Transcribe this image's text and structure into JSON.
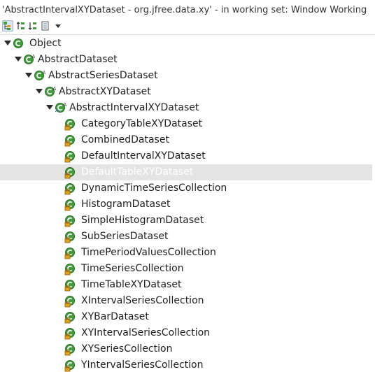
{
  "window": {
    "title": "'AbstractIntervalXYDataset - org.jfree.data.xy' - in working set: Window Working"
  },
  "toolbar": {
    "buttons": [
      {
        "name": "show-type-hierarchy-button",
        "icon": "type-hierarchy-icon",
        "pressed": true
      },
      {
        "name": "show-supertype-hierarchy-button",
        "icon": "supertype-hierarchy-icon",
        "pressed": false
      },
      {
        "name": "show-subtype-hierarchy-button",
        "icon": "subtype-hierarchy-icon",
        "pressed": false
      },
      {
        "name": "history-button",
        "icon": "history-list-icon",
        "pressed": false
      },
      {
        "name": "view-menu-button",
        "icon": "chevron-down-icon",
        "pressed": false
      }
    ]
  },
  "tree": {
    "rows": [
      {
        "label": "Object",
        "depth": 0,
        "expanded": true,
        "kind": "class"
      },
      {
        "label": "AbstractDataset",
        "depth": 1,
        "expanded": true,
        "kind": "abstract"
      },
      {
        "label": "AbstractSeriesDataset",
        "depth": 2,
        "expanded": true,
        "kind": "abstract"
      },
      {
        "label": "AbstractXYDataset",
        "depth": 3,
        "expanded": true,
        "kind": "abstract"
      },
      {
        "label": "AbstractIntervalXYDataset",
        "depth": 4,
        "expanded": true,
        "kind": "abstract-focus"
      },
      {
        "label": "CategoryTableXYDataset",
        "depth": 5,
        "kind": "leaf"
      },
      {
        "label": "CombinedDataset",
        "depth": 5,
        "kind": "leaf"
      },
      {
        "label": "DefaultIntervalXYDataset",
        "depth": 5,
        "kind": "leaf"
      },
      {
        "label": "DefaultTableXYDataset",
        "depth": 5,
        "kind": "leaf",
        "selected": true
      },
      {
        "label": "DynamicTimeSeriesCollection",
        "depth": 5,
        "kind": "leaf"
      },
      {
        "label": "HistogramDataset",
        "depth": 5,
        "kind": "leaf"
      },
      {
        "label": "SimpleHistogramDataset",
        "depth": 5,
        "kind": "leaf"
      },
      {
        "label": "SubSeriesDataset",
        "depth": 5,
        "kind": "leaf"
      },
      {
        "label": "TimePeriodValuesCollection",
        "depth": 5,
        "kind": "leaf"
      },
      {
        "label": "TimeSeriesCollection",
        "depth": 5,
        "kind": "leaf"
      },
      {
        "label": "TimeTableXYDataset",
        "depth": 5,
        "kind": "leaf"
      },
      {
        "label": "XIntervalSeriesCollection",
        "depth": 5,
        "kind": "leaf"
      },
      {
        "label": "XYBarDataset",
        "depth": 5,
        "kind": "leaf"
      },
      {
        "label": "XYIntervalSeriesCollection",
        "depth": 5,
        "kind": "leaf"
      },
      {
        "label": "XYSeriesCollection",
        "depth": 5,
        "kind": "leaf"
      },
      {
        "label": "YIntervalSeriesCollection",
        "depth": 5,
        "kind": "leaf"
      }
    ]
  },
  "colors": {
    "class_icon_fill": "#3f9e3a",
    "class_icon_ring": "#2a6e28",
    "abstract_marker": "#3b3b3b",
    "package_marker": "#e0a21b",
    "selection": "#e4e4e4"
  }
}
